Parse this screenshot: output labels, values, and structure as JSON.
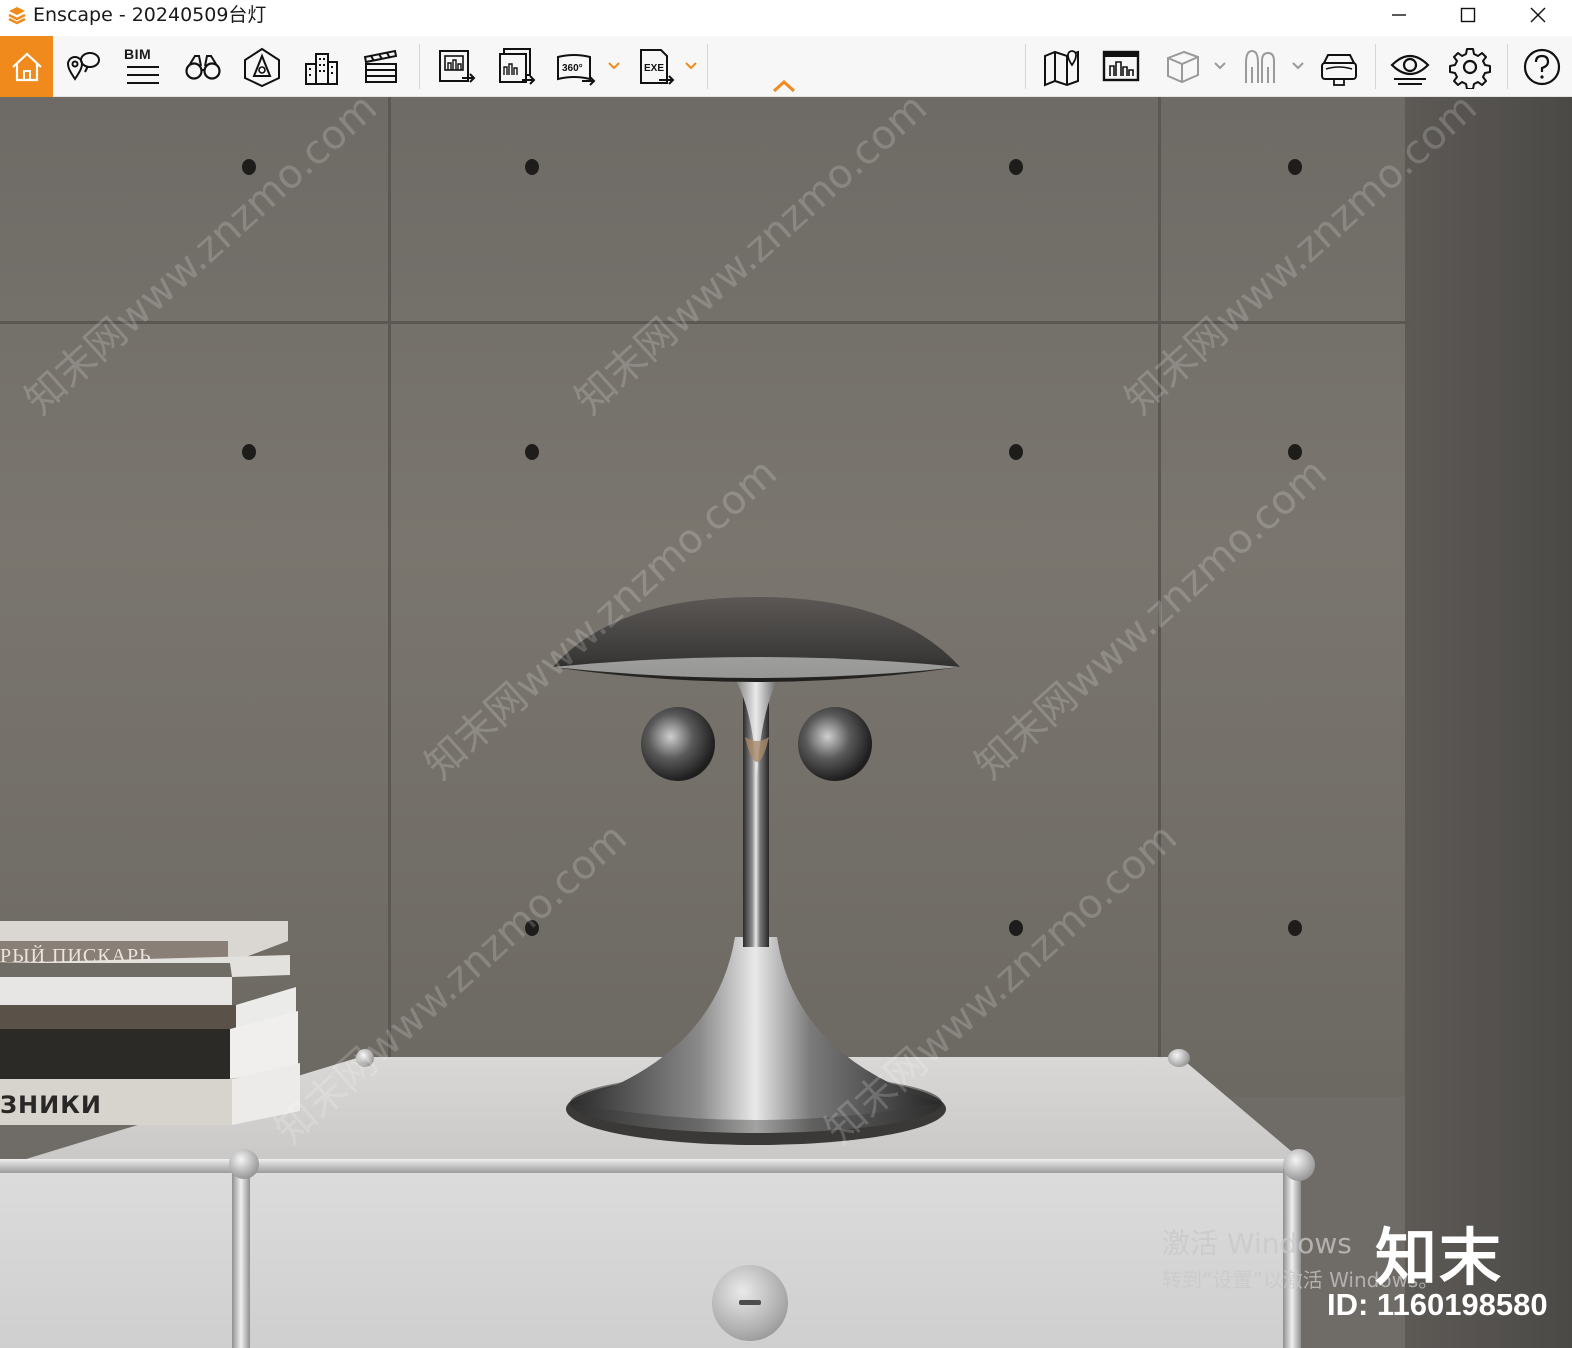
{
  "window": {
    "title": "Enscape - 20240509台灯",
    "controls": [
      "minimize",
      "maximize",
      "close"
    ]
  },
  "toolbar": {
    "left_buttons": [
      {
        "id": "home",
        "icon": "home-icon",
        "active": true
      },
      {
        "id": "views",
        "icon": "location-pins-icon"
      },
      {
        "id": "bim",
        "icon": "bim-icon",
        "label": "BIM"
      },
      {
        "id": "walk",
        "icon": "binoculars-icon"
      },
      {
        "id": "asset-library",
        "icon": "asset-library-icon"
      },
      {
        "id": "atlas",
        "icon": "buildings-icon"
      },
      {
        "id": "video-editor",
        "icon": "clapperboard-icon"
      },
      {
        "id": "render-image",
        "icon": "render-image-icon"
      },
      {
        "id": "batch-render",
        "icon": "batch-render-icon"
      },
      {
        "id": "panorama",
        "icon": "panorama-360-icon",
        "label": "360°"
      },
      {
        "id": "export-exe",
        "icon": "export-exe-icon",
        "label": "EXE"
      }
    ],
    "right_buttons": [
      {
        "id": "map",
        "icon": "map-icon"
      },
      {
        "id": "minimap",
        "icon": "minimap-icon"
      },
      {
        "id": "box",
        "icon": "cube-icon"
      },
      {
        "id": "people",
        "icon": "people-icon"
      },
      {
        "id": "vr",
        "icon": "vr-headset-icon"
      },
      {
        "id": "visual-settings",
        "icon": "eye-icon"
      },
      {
        "id": "settings",
        "icon": "gear-icon"
      },
      {
        "id": "help",
        "icon": "help-icon"
      }
    ],
    "accent_color": "#f08a1c"
  },
  "viewport": {
    "books": [
      {
        "spine_text": "РЫЙ  ПИСКАРЬ"
      },
      {
        "spine_text": "ЗНИКИ"
      }
    ],
    "watermark_text": "知末网www.znzmo.com",
    "activation": {
      "line1": "激活 Windows",
      "line2": "转到“设置”以激活 Windows。"
    },
    "brand": {
      "name": "知末",
      "id_text": "ID: 1160198580"
    }
  }
}
